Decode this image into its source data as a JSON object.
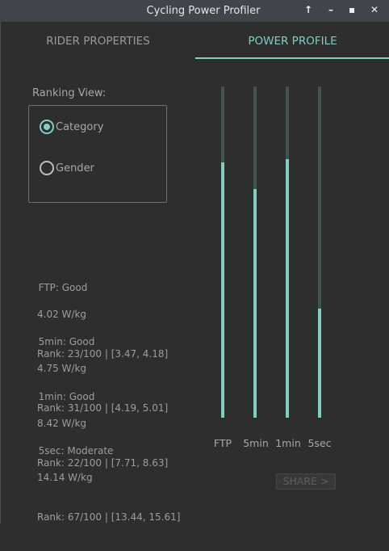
{
  "window": {
    "title": "Cycling Power Profiler",
    "controls": [
      "↑",
      "–",
      "▪",
      "✕"
    ]
  },
  "tabs": [
    {
      "label": "RIDER PROPERTIES",
      "active": false
    },
    {
      "label": "POWER PROFILE",
      "active": true
    }
  ],
  "ranking_view": {
    "label": "Ranking View:",
    "options": [
      {
        "label": "Category",
        "selected": true
      },
      {
        "label": "Gender",
        "selected": false
      }
    ]
  },
  "stats": [
    {
      "heading": "FTP: Good",
      "value": "4.02 W/kg",
      "rank": "Rank: 23/100 | [3.47, 4.18]"
    },
    {
      "heading": "5min: Good",
      "value": "4.75 W/kg",
      "rank": "Rank: 31/100 | [4.19, 5.01]"
    },
    {
      "heading": "1min: Good",
      "value": "8.42 W/kg",
      "rank": "Rank: 22/100 | [7.71, 8.63]"
    },
    {
      "heading": "5sec: Moderate",
      "value": "14.14 W/kg",
      "rank": "Rank: 67/100 | [13.44, 15.61]"
    }
  ],
  "bars": [
    {
      "label": "FTP",
      "level": 0.77
    },
    {
      "label": "5min",
      "level": 0.69
    },
    {
      "label": "1min",
      "level": 0.78
    },
    {
      "label": "5sec",
      "level": 0.33
    }
  ],
  "share_label": "SHARE >",
  "colors": {
    "accent": "#7fcfc3",
    "track": "#3f5551",
    "background": "#2e2e2e",
    "titlebar": "#40444b"
  }
}
